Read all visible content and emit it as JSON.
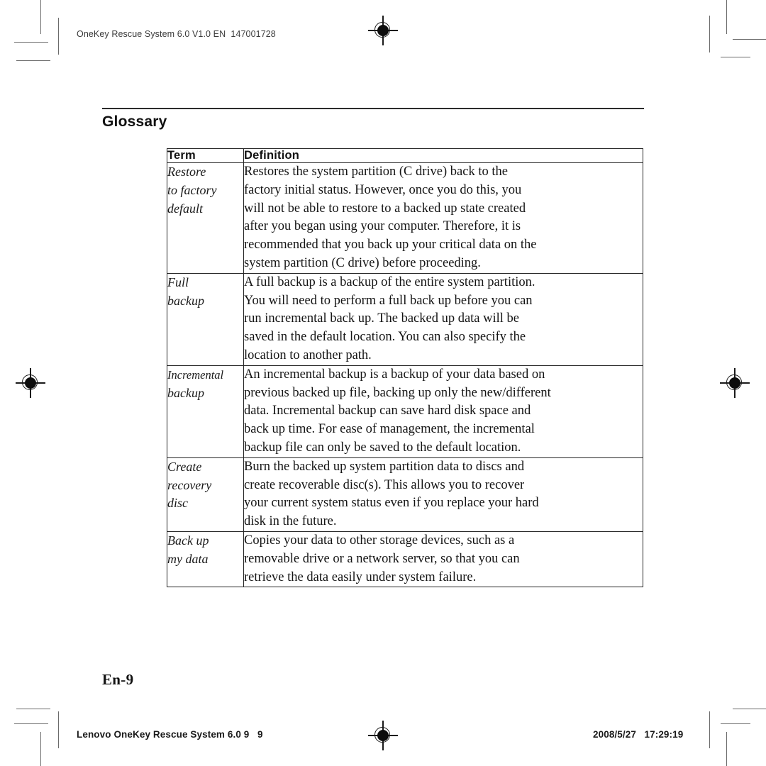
{
  "running_head": "OneKey Rescue System 6.0 V1.0 EN  147001728",
  "heading": "Glossary",
  "page_mark": "En-9",
  "footer": {
    "left": "Lenovo OneKey Rescue System 6.0 9   9",
    "right": "2008/5/27   17:29:19"
  },
  "table": {
    "columns": [
      "Term",
      "Definition"
    ],
    "rows": [
      {
        "term_lines": [
          "Restore",
          "to factory",
          "default"
        ],
        "definition_lines": [
          "Restores the system partition (C drive) back to the",
          "factory initial status. However, once you do this, you",
          "will not be able to restore to a backed up state created",
          "after you began using your computer. Therefore, it is",
          "recommended that you back up your critical data on the",
          "system partition (C drive) before proceeding."
        ]
      },
      {
        "term_lines": [
          "Full",
          "backup"
        ],
        "definition_lines": [
          "A full backup is a backup of the entire system partition.",
          "You will need to perform a full back up before you can",
          "run incremental back up. The backed up data will be",
          "saved in the default location. You can also specify the",
          "location to another path."
        ]
      },
      {
        "term_lines": [
          "Incremental",
          "backup"
        ],
        "definition_lines": [
          "An incremental backup is a backup of your data based on",
          "previous backed up file, backing up only the new/different",
          "data. Incremental backup can save hard disk space and",
          "back up time. For ease of management, the incremental",
          "backup file can only be saved to the default location."
        ]
      },
      {
        "term_lines": [
          "Create",
          "recovery",
          "disc"
        ],
        "definition_lines": [
          "Burn the backed up system partition data to discs and",
          "create recoverable disc(s). This allows you to recover",
          "your current system status even if you replace your hard",
          "disk in the future."
        ]
      },
      {
        "term_lines": [
          "Back up",
          "my data"
        ],
        "definition_lines": [
          "Copies your data to other storage devices, such as a",
          "removable drive or a network server, so that you can",
          "retrieve the data easily under system failure."
        ]
      }
    ]
  }
}
